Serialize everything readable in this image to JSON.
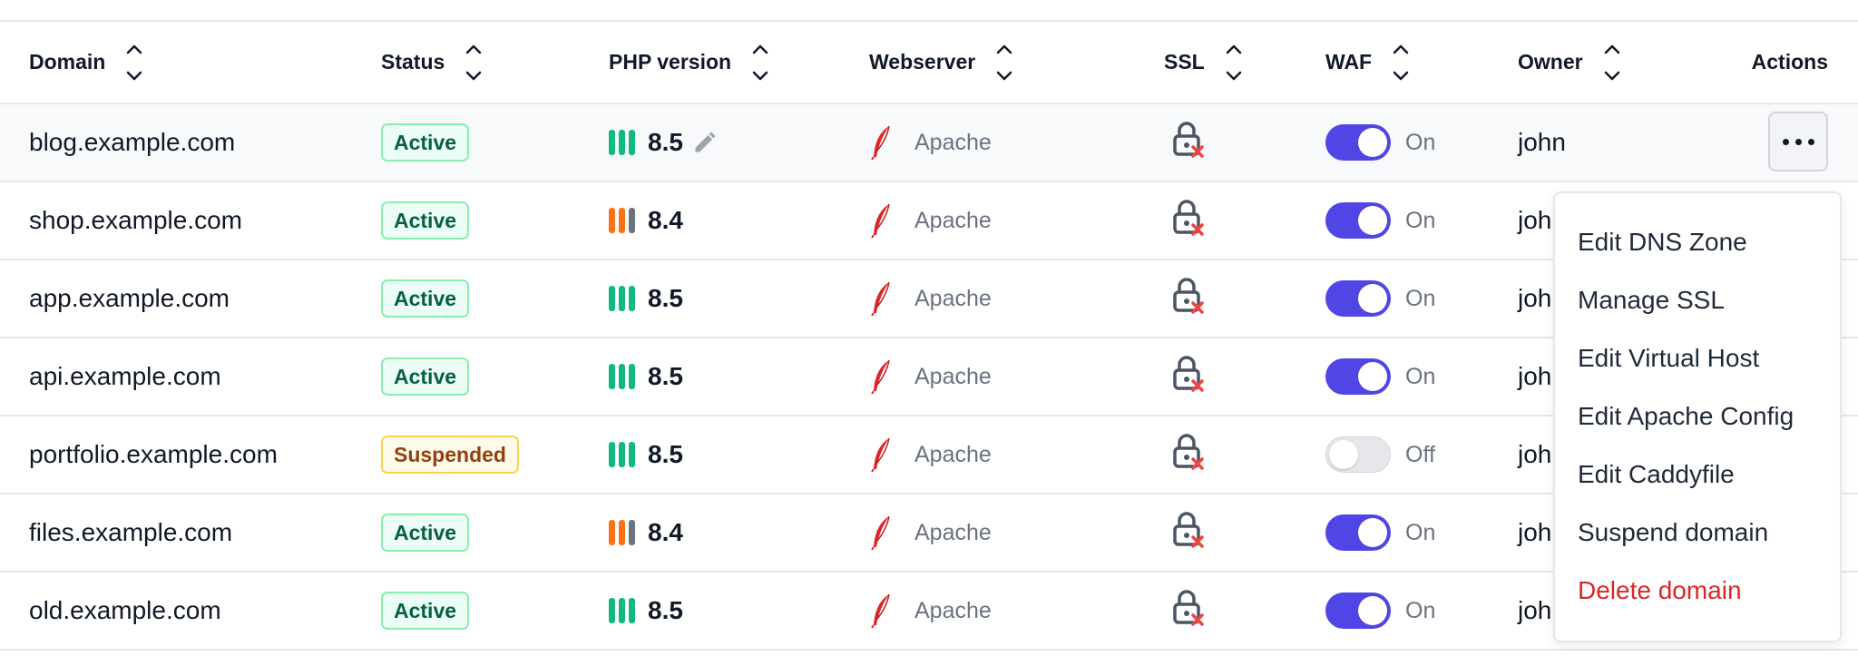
{
  "columns": {
    "domain": "Domain",
    "status": "Status",
    "php": "PHP version",
    "webserver": "Webserver",
    "ssl": "SSL",
    "waf": "WAF",
    "owner": "Owner",
    "actions": "Actions"
  },
  "rows": [
    {
      "domain": "blog.example.com",
      "status": "Active",
      "php": "8.5",
      "webserver": "Apache",
      "waf": "On",
      "owner": "john"
    },
    {
      "domain": "shop.example.com",
      "status": "Active",
      "php": "8.4",
      "webserver": "Apache",
      "waf": "On",
      "owner": "joh"
    },
    {
      "domain": "app.example.com",
      "status": "Active",
      "php": "8.5",
      "webserver": "Apache",
      "waf": "On",
      "owner": "joh"
    },
    {
      "domain": "api.example.com",
      "status": "Active",
      "php": "8.5",
      "webserver": "Apache",
      "waf": "On",
      "owner": "joh"
    },
    {
      "domain": "portfolio.example.com",
      "status": "Suspended",
      "php": "8.5",
      "webserver": "Apache",
      "waf": "Off",
      "owner": "joh"
    },
    {
      "domain": "files.example.com",
      "status": "Active",
      "php": "8.4",
      "webserver": "Apache",
      "waf": "On",
      "owner": "joh"
    },
    {
      "domain": "old.example.com",
      "status": "Active",
      "php": "8.5",
      "webserver": "Apache",
      "waf": "On",
      "owner": "joh"
    }
  ],
  "menu": {
    "edit_dns": "Edit DNS Zone",
    "manage_ssl": "Manage SSL",
    "edit_vhost": "Edit Virtual Host",
    "edit_apache": "Edit Apache Config",
    "edit_caddy": "Edit Caddyfile",
    "suspend": "Suspend domain",
    "delete": "Delete domain"
  },
  "colors": {
    "accent": "#4f46e5",
    "php_ok": "#10b981",
    "php_warn": "#f97316",
    "php_muted": "#6b7280",
    "danger": "#dc2626",
    "apache_feather": "#dc2626"
  }
}
